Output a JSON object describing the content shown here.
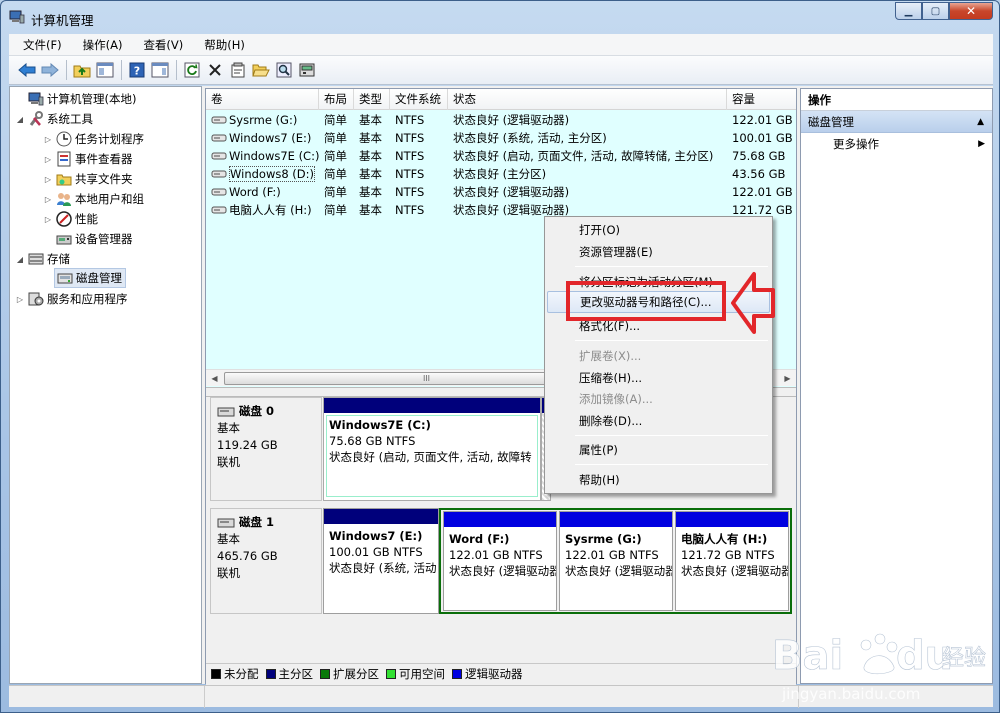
{
  "window": {
    "title": "计算机管理",
    "min": "▁",
    "max": "▢",
    "close": "✕"
  },
  "menubar": [
    {
      "label": "文件(F)"
    },
    {
      "label": "操作(A)"
    },
    {
      "label": "查看(V)"
    },
    {
      "label": "帮助(H)"
    }
  ],
  "tree": [
    {
      "label": "计算机管理(本地)",
      "icon": "computer-icon"
    },
    {
      "label": "系统工具",
      "icon": "tools-icon"
    },
    {
      "label": "任务计划程序",
      "icon": "clock-icon"
    },
    {
      "label": "事件查看器",
      "icon": "event-viewer-icon"
    },
    {
      "label": "共享文件夹",
      "icon": "shared-folder-icon"
    },
    {
      "label": "本地用户和组",
      "icon": "users-icon"
    },
    {
      "label": "性能",
      "icon": "performance-icon"
    },
    {
      "label": "设备管理器",
      "icon": "device-manager-icon"
    },
    {
      "label": "存储",
      "icon": "storage-icon"
    },
    {
      "label": "磁盘管理",
      "icon": "disk-icon"
    },
    {
      "label": "服务和应用程序",
      "icon": "services-icon"
    }
  ],
  "volumes": {
    "headers": {
      "vol": "卷",
      "layout": "布局",
      "type": "类型",
      "fs": "文件系统",
      "status": "状态",
      "capacity": "容量"
    },
    "rows": [
      {
        "name": "Sysrme (G:)",
        "layout": "简单",
        "type": "基本",
        "fs": "NTFS",
        "status": "状态良好 (逻辑驱动器)",
        "capacity": "122.01 GB"
      },
      {
        "name": "Windows7 (E:)",
        "layout": "简单",
        "type": "基本",
        "fs": "NTFS",
        "status": "状态良好 (系统, 活动, 主分区)",
        "capacity": "100.01 GB"
      },
      {
        "name": "Windows7E (C:)",
        "layout": "简单",
        "type": "基本",
        "fs": "NTFS",
        "status": "状态良好 (启动, 页面文件, 活动, 故障转储, 主分区)",
        "capacity": "75.68 GB"
      },
      {
        "name": "Windows8 (D:)",
        "layout": "简单",
        "type": "基本",
        "fs": "NTFS",
        "status": "状态良好 (主分区)",
        "capacity": "43.56 GB"
      },
      {
        "name": "Word (F:)",
        "layout": "简单",
        "type": "基本",
        "fs": "NTFS",
        "status": "状态良好 (逻辑驱动器)",
        "capacity": "122.01 GB"
      },
      {
        "name": "电脑人人有 (H:)",
        "layout": "简单",
        "type": "基本",
        "fs": "NTFS",
        "status": "状态良好 (逻辑驱动器)",
        "capacity": "121.72 GB"
      }
    ]
  },
  "scroll_grip": "III",
  "disks": [
    {
      "name": "磁盘 0",
      "type": "基本",
      "size": "119.24 GB",
      "status": "联机",
      "partitions": [
        {
          "name": "Windows7E  (C:)",
          "size": "75.68 GB NTFS",
          "status": "状态良好 (启动, 页面文件, 活动, 故障转"
        }
      ]
    },
    {
      "name": "磁盘 1",
      "type": "基本",
      "size": "465.76 GB",
      "status": "联机",
      "partitions": [
        {
          "name": "Windows7  (E:)",
          "size": "100.01 GB NTFS",
          "status": "状态良好 (系统, 活动"
        },
        {
          "name": "Word  (F:)",
          "size": "122.01 GB NTFS",
          "status": "状态良好 (逻辑驱动器"
        },
        {
          "name": "Sysrme  (G:)",
          "size": "122.01 GB NTFS",
          "status": "状态良好 (逻辑驱动器"
        },
        {
          "name": "电脑人人有  (H:)",
          "size": "121.72 GB NTFS",
          "status": "状态良好 (逻辑驱动器"
        }
      ]
    }
  ],
  "legend": [
    {
      "label": "未分配",
      "color": "#000000"
    },
    {
      "label": "主分区",
      "color": "#00007b"
    },
    {
      "label": "扩展分区",
      "color": "#0a7a0a"
    },
    {
      "label": "可用空间",
      "color": "#33e033"
    },
    {
      "label": "逻辑驱动器",
      "color": "#0000e0"
    }
  ],
  "actions": {
    "header": "操作",
    "section": "磁盘管理",
    "more": "更多操作"
  },
  "context_menu": [
    {
      "label": "打开(O)",
      "state": "normal"
    },
    {
      "label": "资源管理器(E)",
      "state": "normal"
    },
    {
      "label": "将分区标记为活动分区(M)",
      "state": "normal"
    },
    {
      "label": "更改驱动器号和路径(C)...",
      "state": "highlighted"
    },
    {
      "label": "格式化(F)...",
      "state": "normal"
    },
    {
      "label": "扩展卷(X)...",
      "state": "disabled"
    },
    {
      "label": "压缩卷(H)...",
      "state": "normal"
    },
    {
      "label": "添加镜像(A)...",
      "state": "disabled"
    },
    {
      "label": "删除卷(D)...",
      "state": "normal"
    },
    {
      "label": "属性(P)",
      "state": "normal"
    },
    {
      "label": "帮助(H)",
      "state": "normal"
    }
  ],
  "colors": {
    "primary": "#00007b",
    "logical": "#0000e0",
    "extended": "#0a7a0a",
    "highlight_box": "#e2262a",
    "volume_bg": "#e0ffff"
  },
  "watermark": {
    "brand": "Bai",
    "brand2": "du",
    "brand3": "经验",
    "url": "jingyan.baidu.com"
  }
}
